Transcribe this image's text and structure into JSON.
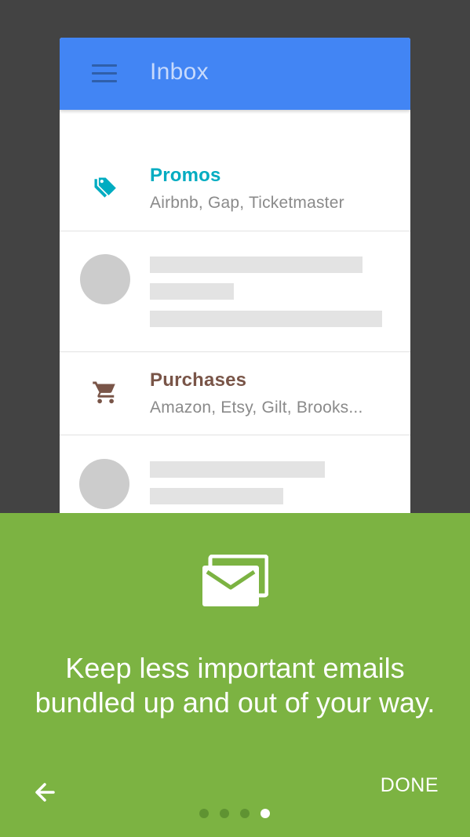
{
  "colors": {
    "background": "#434343",
    "appbar": "#4285f4",
    "promos_accent": "#00acc1",
    "purchases_accent": "#795548",
    "panel": "#7cb342"
  },
  "inbox": {
    "title": "Inbox",
    "menu_icon": "menu-icon",
    "rows": [
      {
        "type": "bundle",
        "icon": "tag-icon",
        "title": "Promos",
        "subtitle": "Airbnb, Gap, Ticketmaster"
      },
      {
        "type": "placeholder"
      },
      {
        "type": "bundle",
        "icon": "cart-icon",
        "title": "Purchases",
        "subtitle": "Amazon, Etsy, Gilt, Brooks..."
      },
      {
        "type": "placeholder"
      }
    ]
  },
  "onboarding": {
    "icon": "stacked-mail-icon",
    "message": "Keep less important emails bundled up and out of your way.",
    "back_icon": "arrow-left-icon",
    "done_label": "DONE",
    "page_count": 4,
    "current_page": 4
  }
}
